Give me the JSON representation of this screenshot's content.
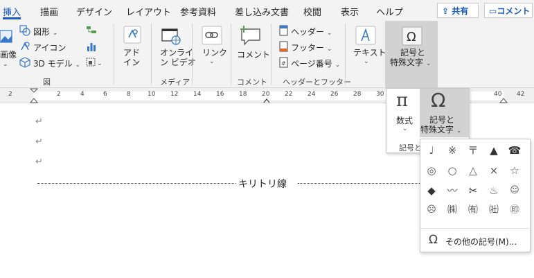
{
  "tabs": [
    "挿入",
    "描画",
    "デザイン",
    "レイアウト",
    "参考資料",
    "差し込み文書",
    "校閲",
    "表示",
    "ヘルプ"
  ],
  "share_label": "共有",
  "comment_btn_label": "コメント",
  "ribbon": {
    "image_label": "画像",
    "shapes_label": "図形",
    "icons_label": "アイコン",
    "model3d_label": "3D モデル",
    "illustrations_group": "図",
    "addins_label_1": "アド",
    "addins_label_2": "イン",
    "online_video_label_1": "オンライ",
    "online_video_label_2": "ン ビデオ",
    "media_group": "メディア",
    "link_label": "リンク",
    "comment_label": "コメント",
    "comment_group": "コメント",
    "header_label": "ヘッダー",
    "footer_label": "フッター",
    "page_number_label": "ページ番号",
    "header_footer_group": "ヘッダーとフッター",
    "text_label": "テキスト",
    "symbols_label_1": "記号と",
    "symbols_label_2": "特殊文字"
  },
  "ruler_numbers": [
    "2",
    "2",
    "4",
    "6",
    "8",
    "10",
    "12",
    "14",
    "16",
    "18",
    "20",
    "22",
    "24",
    "26",
    "28",
    "30",
    "40",
    "42"
  ],
  "document": {
    "para_mark": "↵",
    "cut_line_text": "キリトリ線"
  },
  "flyout": {
    "equation_glyph": "π",
    "equation_label": "数式",
    "symbol_glyph": "Ω",
    "symbol_label_1": "記号と",
    "symbol_label_2": "特殊文字",
    "group_label": "記号と"
  },
  "symbols_panel": {
    "symbols": [
      "♩",
      "※",
      "〒",
      "▲",
      "☎",
      "◎",
      "○",
      "△",
      "×",
      "☆",
      "◆",
      "〰",
      "✂",
      "♨",
      "☺",
      "☹",
      "㈱",
      "㈲",
      "㈳",
      "㊞"
    ],
    "more_label": "その他の記号(M)..."
  }
}
